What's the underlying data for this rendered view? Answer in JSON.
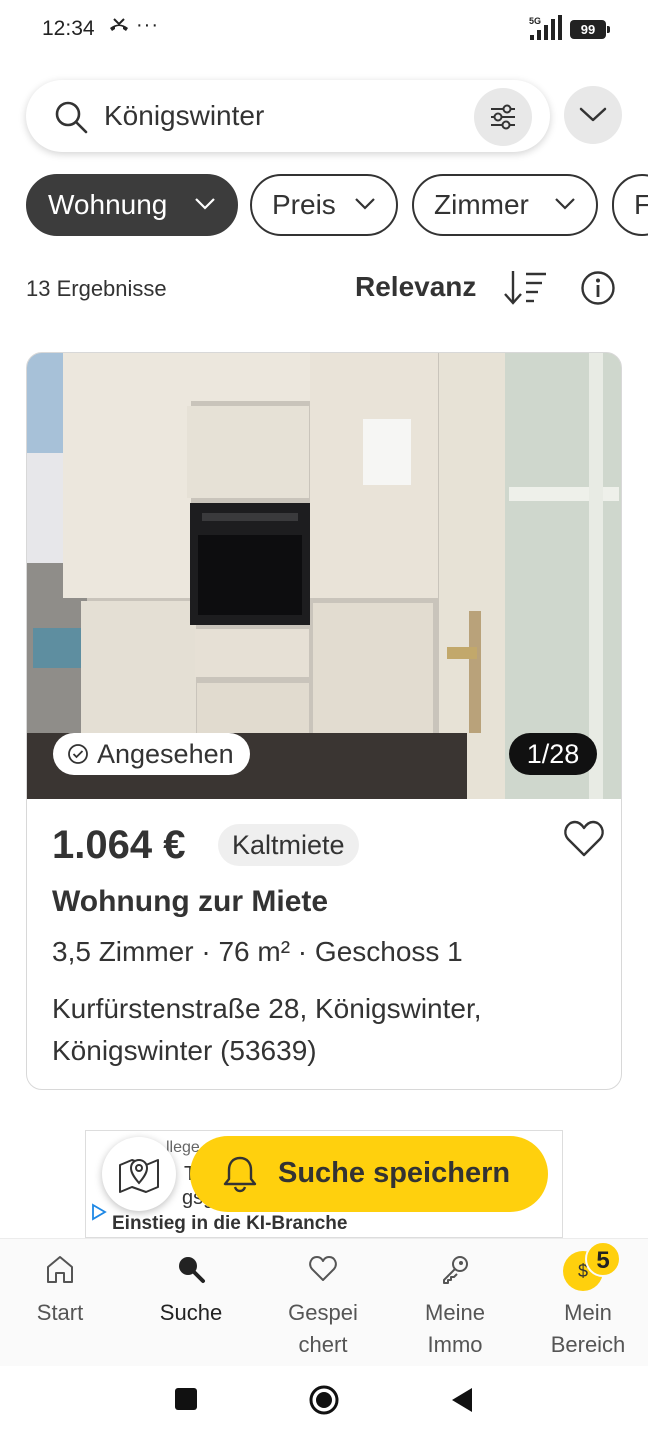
{
  "status_bar": {
    "time": "12:34",
    "phone_icon": "missed-call-icon",
    "more": "···",
    "network": "5G",
    "battery": "99"
  },
  "search": {
    "value": "Königswinter",
    "placeholder": "",
    "icon": "search-icon",
    "filter_icon": "sliders-icon"
  },
  "chips": [
    {
      "label": "Wohnung",
      "active": true
    },
    {
      "label": "Preis",
      "active": false
    },
    {
      "label": "Zimmer",
      "active": false
    },
    {
      "label": "F",
      "active": false
    }
  ],
  "results": {
    "count_label": "13 Ergebnisse",
    "sort_label": "Relevanz"
  },
  "listing": {
    "seen_label": "Angesehen",
    "gallery_counter": "1/28",
    "price": "1.064 €",
    "rent_type": "Kaltmiete",
    "title": "Wohnung zur Miete",
    "details": "3,5 Zimmer · 76 m² · Geschoss 1",
    "address": "Kurfürstenstraße 28, Königswinter, Königswinter (53639)"
  },
  "ad": {
    "fragment_1": "llege",
    "fragment_2": "Ti",
    "fragment_3": "gsg",
    "text": "Einstieg in die KI-Branche"
  },
  "save_search": {
    "label": "Suche speichern"
  },
  "bottom_nav": {
    "items": [
      {
        "label": "Start",
        "icon": "home-icon"
      },
      {
        "label": "Suche",
        "icon": "search-icon"
      },
      {
        "label": "Gespei chert",
        "icon": "heart-icon"
      },
      {
        "label": "Meine Immo",
        "icon": "key-icon"
      },
      {
        "label": "Mein Bereich",
        "icon": "coin-icon"
      }
    ],
    "coin_symbol": "$",
    "coin_count": "5"
  },
  "colors": {
    "accent": "#ffd00d",
    "chip_active": "#3c3c3c",
    "text": "#333333"
  }
}
